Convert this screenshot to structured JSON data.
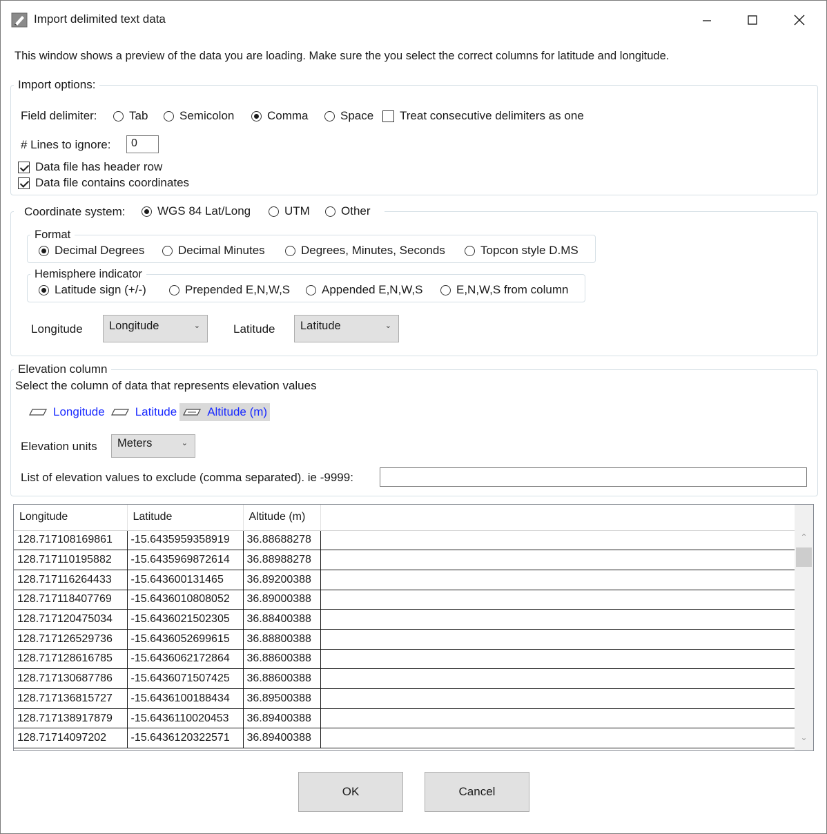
{
  "window": {
    "title": "Import delimited text data"
  },
  "info_text": "This window shows a preview of the data you are loading. Make sure the you select the correct columns for latitude and longitude.",
  "import_options": {
    "legend": "Import options:",
    "field_delimiter_label": "Field delimiter:",
    "delimiters": [
      {
        "label": "Tab",
        "selected": false
      },
      {
        "label": "Semicolon",
        "selected": false
      },
      {
        "label": "Comma",
        "selected": true
      },
      {
        "label": "Space",
        "selected": false
      }
    ],
    "consecutive_label": "Treat consecutive delimiters as one",
    "consecutive_checked": false,
    "lines_to_ignore_label": "# Lines to ignore:",
    "lines_to_ignore_value": "0",
    "header_row_label": "Data file has header row",
    "header_row_checked": true,
    "contains_coords_label": "Data file contains coordinates",
    "contains_coords_checked": true
  },
  "coordinate_system": {
    "label": "Coordinate system:",
    "options": [
      {
        "label": "WGS 84 Lat/Long",
        "selected": true
      },
      {
        "label": "UTM",
        "selected": false
      },
      {
        "label": "Other",
        "selected": false
      }
    ],
    "format": {
      "legend": "Format",
      "options": [
        {
          "label": "Decimal Degrees",
          "selected": true
        },
        {
          "label": "Decimal Minutes",
          "selected": false
        },
        {
          "label": "Degrees, Minutes, Seconds",
          "selected": false
        },
        {
          "label": "Topcon style D.MS",
          "selected": false
        }
      ]
    },
    "hemisphere": {
      "legend": "Hemisphere indicator",
      "options": [
        {
          "label": "Latitude sign (+/-)",
          "selected": true
        },
        {
          "label": "Prepended E,N,W,S",
          "selected": false
        },
        {
          "label": "Appended E,N,W,S",
          "selected": false
        },
        {
          "label": "E,N,W,S from column",
          "selected": false
        }
      ]
    },
    "longitude_label": "Longitude",
    "longitude_value": "Longitude",
    "latitude_label": "Latitude",
    "latitude_value": "Latitude"
  },
  "elevation": {
    "legend": "Elevation column",
    "description": "Select the column of data that represents elevation values",
    "columns": [
      {
        "label": "Longitude",
        "selected": false
      },
      {
        "label": "Latitude",
        "selected": false
      },
      {
        "label": "Altitude (m)",
        "selected": true
      }
    ],
    "units_label": "Elevation units",
    "units_value": "Meters",
    "exclude_label": "List of elevation values to exclude (comma separated). ie -9999:",
    "exclude_value": ""
  },
  "grid": {
    "headers": [
      "Longitude",
      "Latitude",
      "Altitude (m)"
    ],
    "rows": [
      [
        "128.717108169861",
        "-15.6435959358919",
        "36.88688278"
      ],
      [
        "128.717110195882",
        "-15.6435969872614",
        "36.88988278"
      ],
      [
        "128.717116264433",
        "-15.643600131465",
        "36.89200388"
      ],
      [
        "128.717118407769",
        "-15.6436010808052",
        "36.89000388"
      ],
      [
        "128.717120475034",
        "-15.6436021502305",
        "36.88400388"
      ],
      [
        "128.717126529736",
        "-15.6436052699615",
        "36.88800388"
      ],
      [
        "128.717128616785",
        "-15.6436062172864",
        "36.88600388"
      ],
      [
        "128.717130687786",
        "-15.6436071507425",
        "36.88600388"
      ],
      [
        "128.717136815727",
        "-15.6436100188434",
        "36.89500388"
      ],
      [
        "128.717138917879",
        "-15.6436110020453",
        "36.89400388"
      ],
      [
        "128.71714097202",
        "-15.6436120322571",
        "36.89400388"
      ]
    ]
  },
  "buttons": {
    "ok": "OK",
    "cancel": "Cancel"
  }
}
